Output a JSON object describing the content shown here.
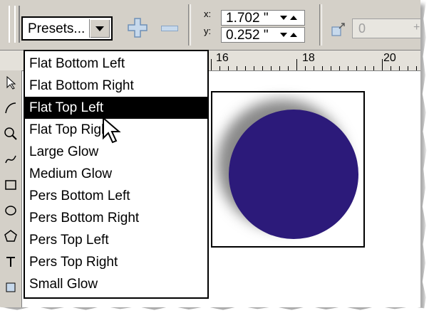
{
  "toolbar": {
    "presets_label": "Presets...",
    "x_label": "x:",
    "y_label": "y:",
    "x_value": "1.702 \"",
    "y_value": "0.252 \"",
    "offset_value": "0"
  },
  "ruler": {
    "labels": [
      "16",
      "18",
      "20"
    ]
  },
  "presets_menu": {
    "items": [
      "Flat Bottom Left",
      "Flat Bottom Right",
      "Flat Top Left",
      "Flat Top Right",
      "Large Glow",
      "Medium Glow",
      "Pers Bottom Left",
      "Pers Bottom Right",
      "Pers Top Left",
      "Pers Top Right",
      "Small Glow"
    ],
    "selected_index": 2
  },
  "colors": {
    "circle_fill": "#2c1a7a",
    "menu_highlight": "#000000",
    "ui_face": "#d4d0c8"
  },
  "icons": [
    "add-preset-icon",
    "remove-preset-icon",
    "spin-down-icon",
    "spin-up-icon",
    "shadow-offset-icon",
    "mouse-cursor-icon"
  ]
}
